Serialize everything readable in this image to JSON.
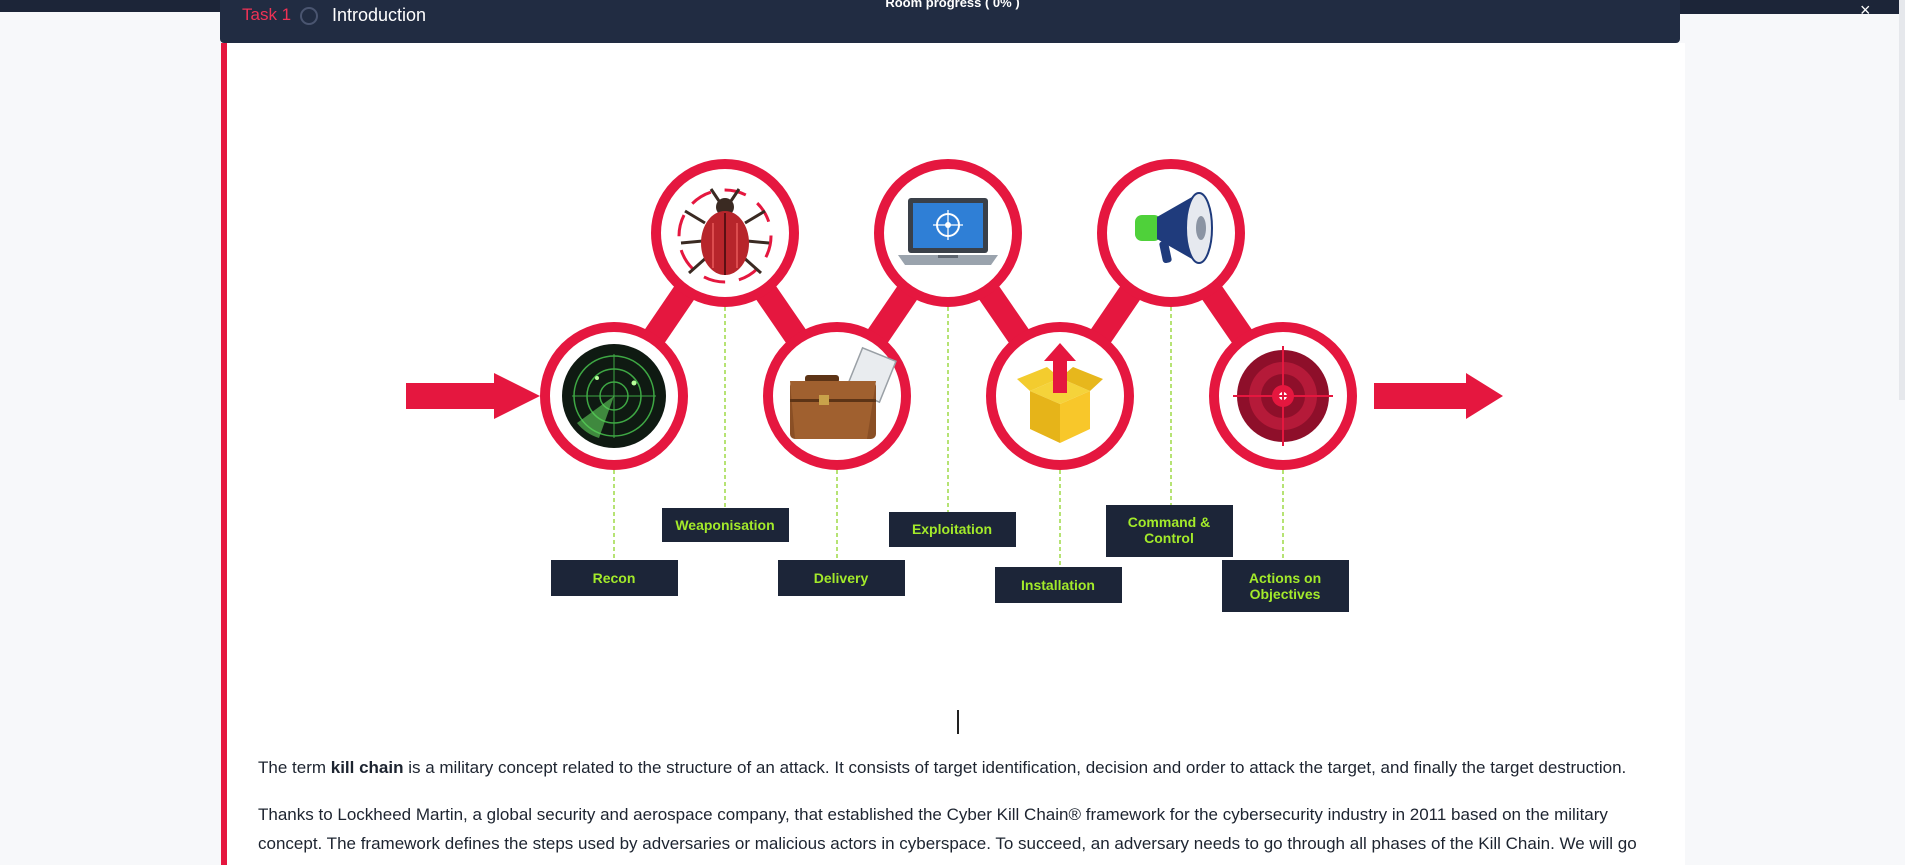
{
  "header": {
    "task_label": "Task 1",
    "task_title": "Introduction",
    "progress_label": "Room progress ( 0% )",
    "close_symbol": "×"
  },
  "diagram": {
    "phases": [
      "Recon",
      "Weaponisation",
      "Delivery",
      "Exploitation",
      "Installation",
      "Command & Control",
      "Actions on Objectives"
    ],
    "icons": [
      "radar-icon",
      "bug-icon",
      "briefcase-icon",
      "laptop-icon",
      "package-icon",
      "megaphone-icon",
      "target-icon"
    ],
    "accent_color": "#e5173f",
    "label_bg_color": "#1c2538",
    "label_text_color": "#a3ea2a"
  },
  "content": {
    "p1_before": "The term ",
    "p1_bold": "kill chain",
    "p1_after": " is a military concept related to the structure of an attack. It consists of target identification, decision and order to attack the target, and finally the target destruction.",
    "p2": "Thanks to Lockheed Martin, a global security and aerospace company, that established the Cyber Kill Chain® framework for the cybersecurity industry in 2011 based on the military concept. The framework defines the steps used by adversaries or malicious actors in cyberspace. To succeed, an adversary needs to go through all phases of the Kill Chain. We will go"
  }
}
